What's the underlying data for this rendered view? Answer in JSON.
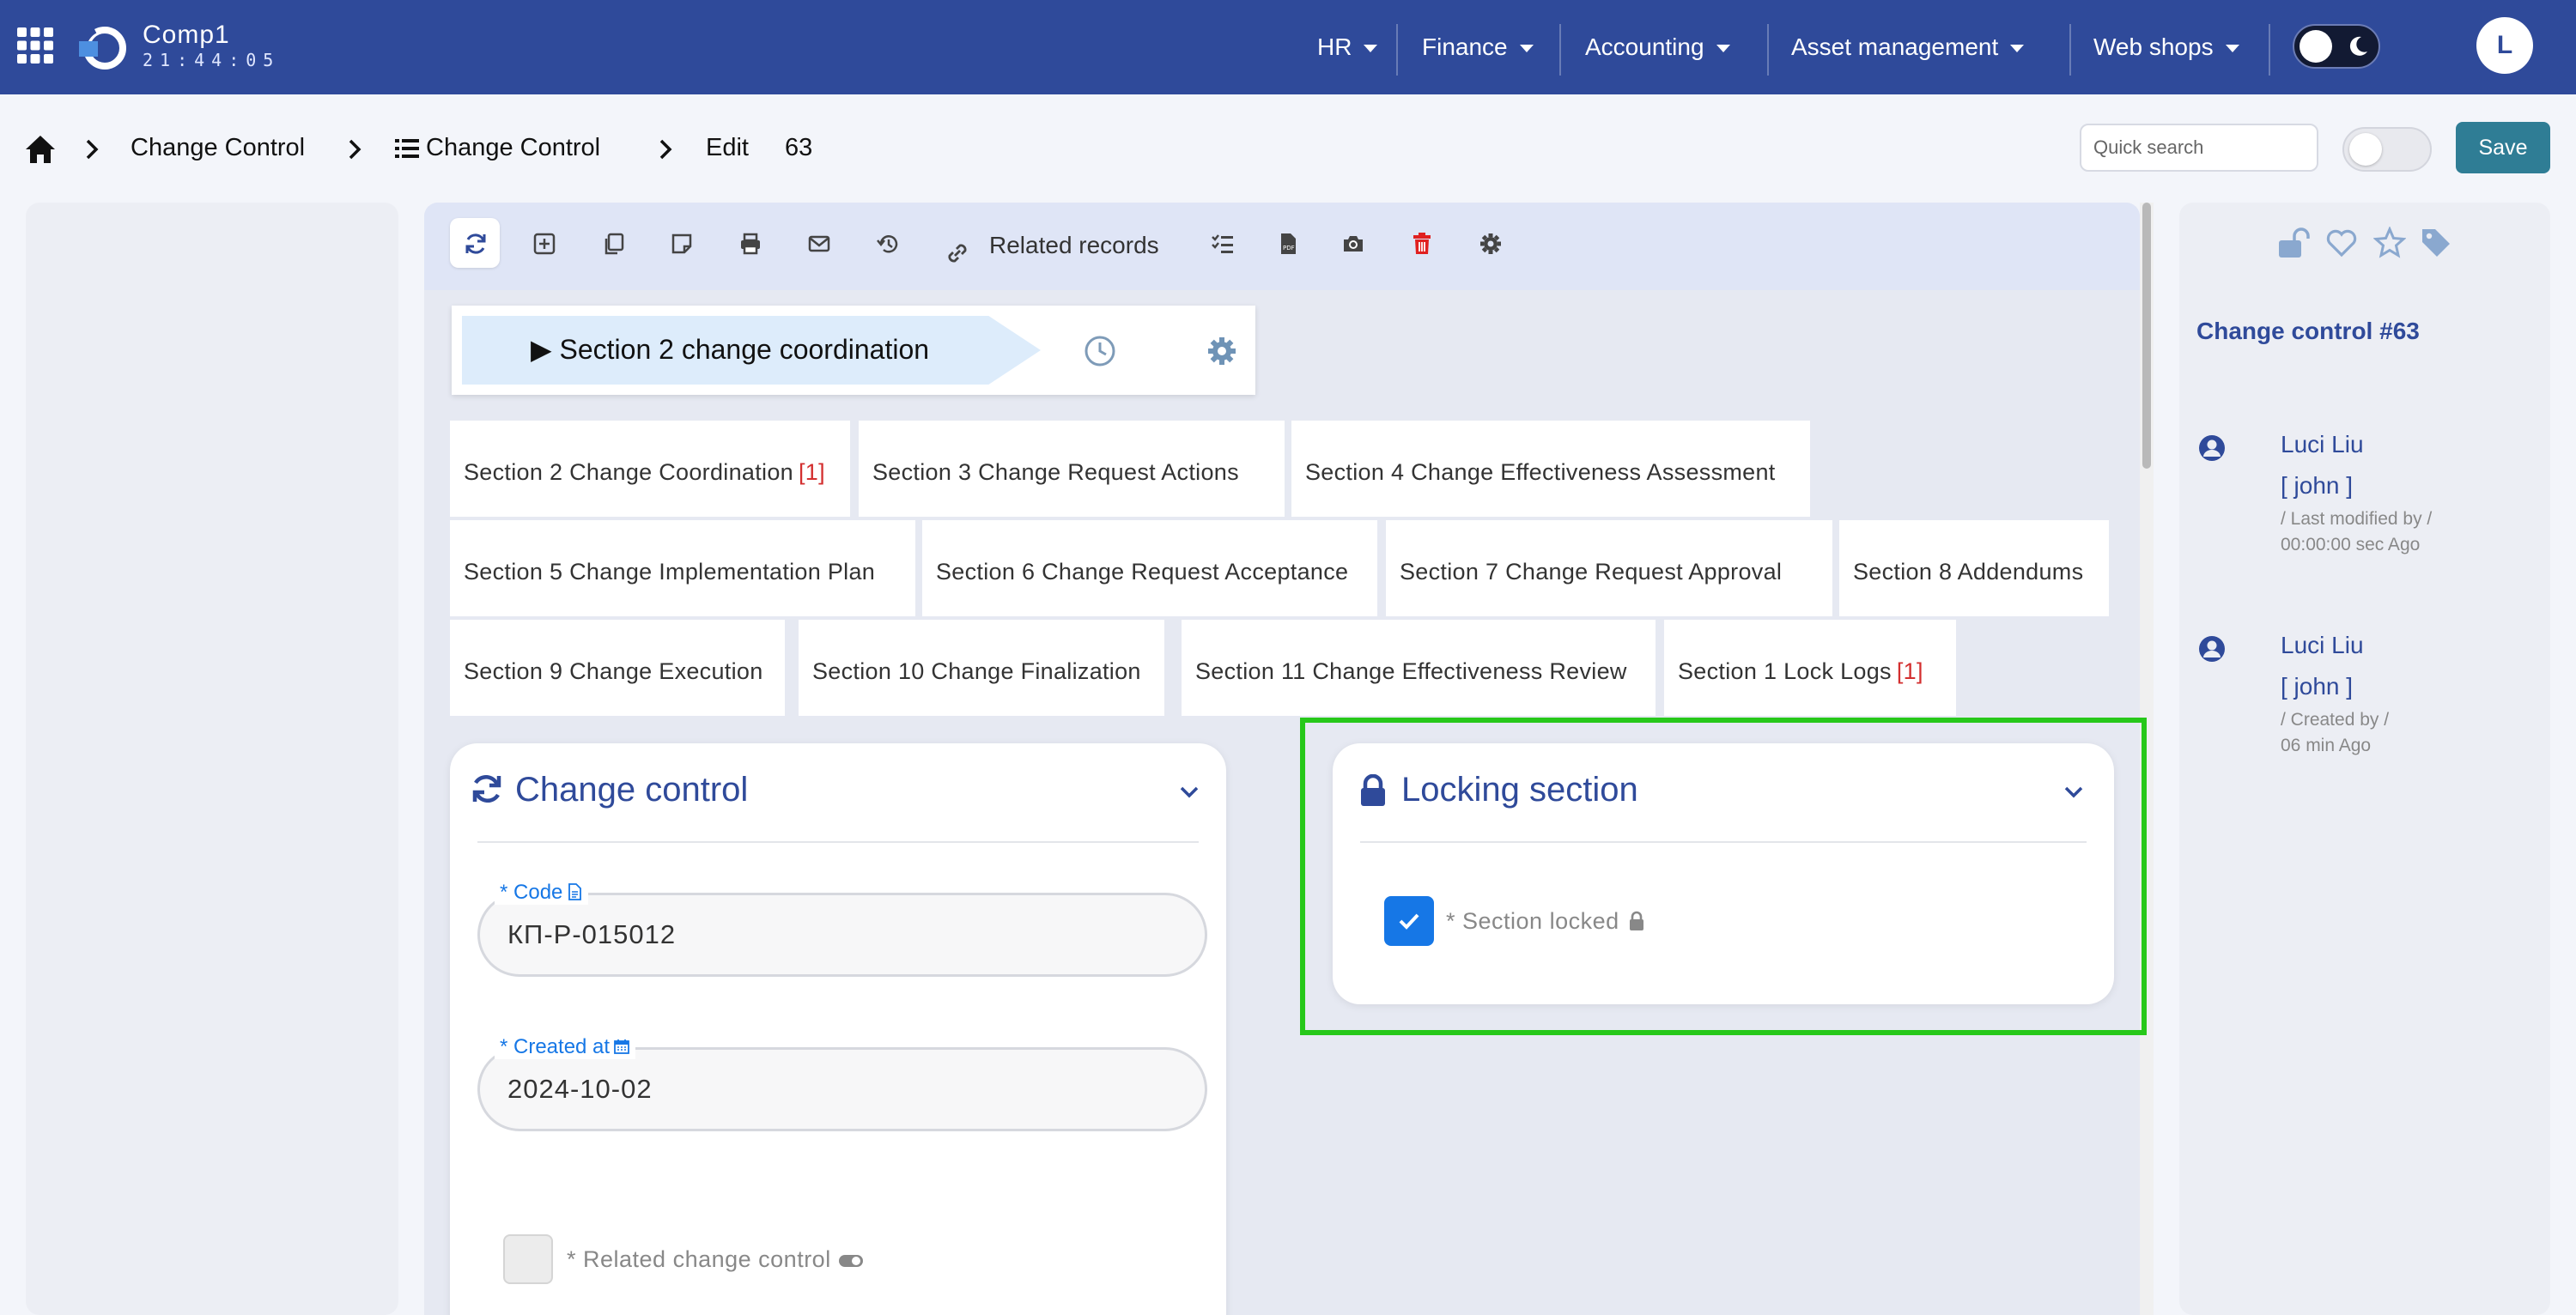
{
  "header": {
    "company": "Comp1",
    "clock": "21:44:05",
    "menus": [
      "HR",
      "Finance",
      "Accounting",
      "Asset management",
      "Web shops"
    ],
    "avatar_initial": "L"
  },
  "breadcrumb": {
    "module": "Change Control",
    "list": "Change Control",
    "edit_label": "Edit",
    "record_id": "63"
  },
  "actions": {
    "search_placeholder": "Quick search",
    "save_label": "Save"
  },
  "toolbar": {
    "related_records": "Related records"
  },
  "workflow": {
    "current_step": "▶ Section 2 change coordination"
  },
  "tabs": [
    {
      "label": "Section 2 Change Coordination",
      "count": "[1]"
    },
    {
      "label": "Section 3 Change Request Actions",
      "count": ""
    },
    {
      "label": "Section 4 Change Effectiveness Assessment",
      "count": ""
    },
    {
      "label": "Section 5 Change Implementation Plan",
      "count": ""
    },
    {
      "label": "Section 6 Change Request Acceptance",
      "count": ""
    },
    {
      "label": "Section 7 Change Request Approval",
      "count": ""
    },
    {
      "label": "Section 8 Addendums",
      "count": ""
    },
    {
      "label": "Section 9 Change Execution",
      "count": ""
    },
    {
      "label": "Section 10 Change Finalization",
      "count": ""
    },
    {
      "label": "Section 11 Change Effectiveness Review",
      "count": ""
    },
    {
      "label": "Section 1 Lock Logs",
      "count": "[1]"
    }
  ],
  "change_control_card": {
    "title": "Change control",
    "code_label": "* Code",
    "code_value": "КП-Р-015012",
    "created_label": "* Created at",
    "created_value": "2024-10-02",
    "related_label": "* Related change control"
  },
  "locking_card": {
    "title": "Locking section",
    "section_locked_label": "* Section locked",
    "section_locked": true
  },
  "record_panel": {
    "title": "Change control #63",
    "history": [
      {
        "name": "Luci Liu",
        "user": "[ john ]",
        "action": "/ Last modified by /",
        "time": "00:00:00 sec Ago"
      },
      {
        "name": "Luci Liu",
        "user": "[ john ]",
        "action": "/ Created by /",
        "time": "06 min Ago"
      }
    ]
  },
  "colors": {
    "navbar": "#2f4a9a",
    "accent_blue": "#1677e6",
    "save_button": "#2f7d95",
    "count_red": "#d32f2f",
    "highlight_green": "#27c81a"
  }
}
